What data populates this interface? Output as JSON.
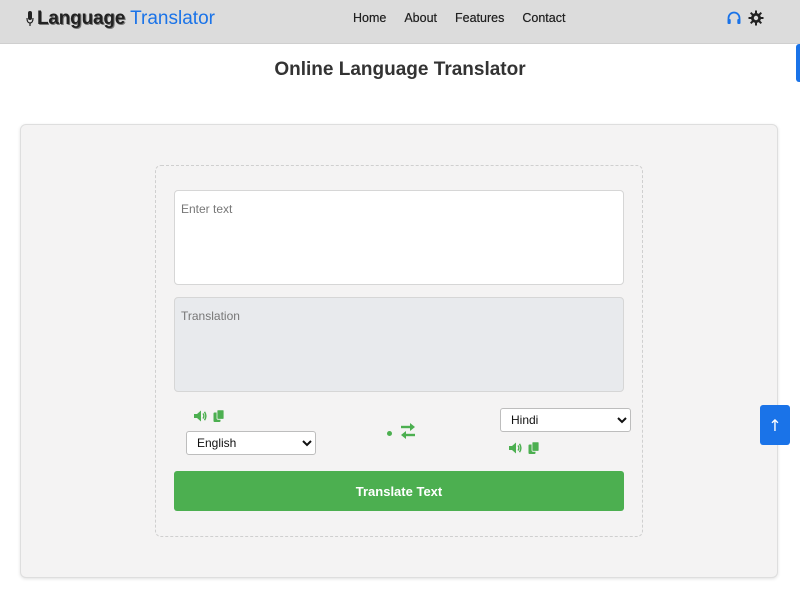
{
  "header": {
    "logo_bold": "Language",
    "logo_light": "Translator",
    "nav": [
      "Home",
      "About",
      "Features",
      "Contact"
    ],
    "icons": [
      "headset-icon",
      "gear-icon"
    ]
  },
  "main": {
    "title": "Online Language Translator",
    "input_placeholder": "Enter text",
    "output_placeholder": "Translation",
    "from_language": "English",
    "to_language": "Hindi",
    "translate_label": "Translate Text",
    "scroll_top_label": "↑"
  },
  "colors": {
    "accent_green": "#4caf50",
    "brand_blue": "#1a73e8",
    "header_bg": "#dcdcdc"
  }
}
